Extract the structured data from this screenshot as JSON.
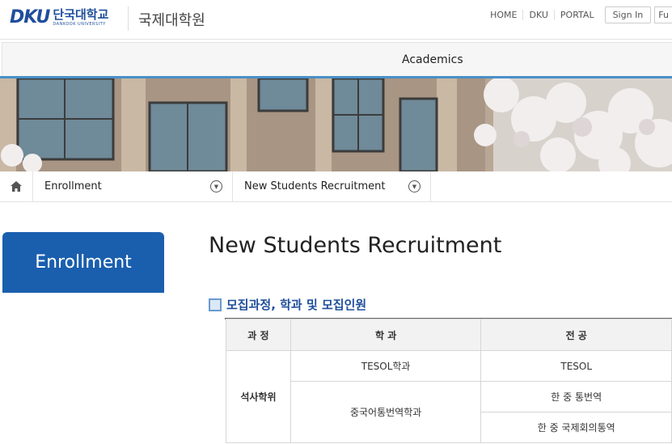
{
  "header": {
    "logo_mark": "DKU",
    "logo_korean": "단국대학교",
    "logo_english": "DANKOOK UNIVERSITY",
    "site_title": "국제대학원",
    "util_links": [
      "HOME",
      "DKU",
      "PORTAL"
    ],
    "sign_in": "Sign In",
    "cut_button": "Fu"
  },
  "gnb": {
    "label": "Academics"
  },
  "breadcrumb": {
    "level1": "Enrollment",
    "level2": "New Students Recruitment"
  },
  "side": {
    "title": "Enrollment"
  },
  "main": {
    "title": "New Students Recruitment",
    "section_heading": "모집과정, 학과 및 모집인원",
    "table": {
      "headers": [
        "과 정",
        "학 과",
        "전 공"
      ],
      "course": "석사학위",
      "rows": [
        {
          "dept": "TESOL학과",
          "major": "TESOL"
        },
        {
          "dept": "중국어통번역학과",
          "major": "한 중 통번역"
        },
        {
          "dept": "",
          "major": "한 중 국제회의통역"
        }
      ]
    }
  },
  "colors": {
    "brand_blue": "#1f4e9c",
    "side_blue": "#1a5fae",
    "accent_line": "#4a90c8"
  }
}
